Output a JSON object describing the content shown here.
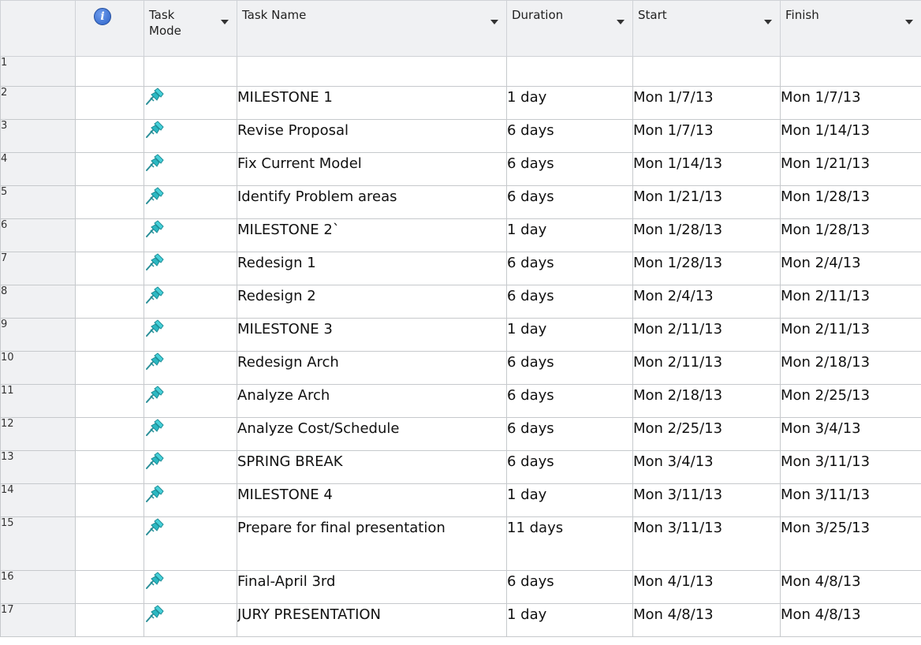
{
  "header": {
    "task_mode_label": "Task\nMode",
    "task_name_label": "Task Name",
    "duration_label": "Duration",
    "start_label": "Start",
    "finish_label": "Finish"
  },
  "icons": {
    "info": "info-icon",
    "task_mode": "pushpin-icon",
    "sort": "chevron-down-icon"
  },
  "colors": {
    "selected_header": "#fbd34d",
    "pin": "#27b3bd"
  },
  "rows": [
    {
      "id": "1",
      "name": "",
      "duration": "",
      "start": "",
      "finish": ""
    },
    {
      "id": "2",
      "name": "MILESTONE 1",
      "duration": "1 day",
      "start": "Mon 1/7/13",
      "finish": "Mon 1/7/13"
    },
    {
      "id": "3",
      "name": "Revise Proposal",
      "duration": "6 days",
      "start": "Mon 1/7/13",
      "finish": "Mon 1/14/13"
    },
    {
      "id": "4",
      "name": "Fix Current Model",
      "duration": "6 days",
      "start": "Mon 1/14/13",
      "finish": "Mon 1/21/13"
    },
    {
      "id": "5",
      "name": "Identify Problem areas",
      "duration": "6 days",
      "start": "Mon 1/21/13",
      "finish": "Mon 1/28/13"
    },
    {
      "id": "6",
      "name": "MILESTONE 2`",
      "duration": "1 day",
      "start": "Mon 1/28/13",
      "finish": "Mon 1/28/13"
    },
    {
      "id": "7",
      "name": "Redesign 1",
      "duration": "6 days",
      "start": "Mon 1/28/13",
      "finish": "Mon 2/4/13"
    },
    {
      "id": "8",
      "name": "Redesign 2",
      "duration": "6 days",
      "start": "Mon 2/4/13",
      "finish": "Mon 2/11/13"
    },
    {
      "id": "9",
      "name": "MILESTONE 3",
      "duration": "1 day",
      "start": "Mon 2/11/13",
      "finish": "Mon 2/11/13"
    },
    {
      "id": "10",
      "name": "Redesign Arch",
      "duration": "6 days",
      "start": "Mon 2/11/13",
      "finish": "Mon 2/18/13"
    },
    {
      "id": "11",
      "name": "Analyze Arch",
      "duration": "6 days",
      "start": "Mon 2/18/13",
      "finish": "Mon 2/25/13"
    },
    {
      "id": "12",
      "name": "Analyze Cost/Schedule",
      "duration": "6 days",
      "start": "Mon 2/25/13",
      "finish": "Mon 3/4/13"
    },
    {
      "id": "13",
      "name": "SPRING BREAK",
      "duration": "6 days",
      "start": "Mon 3/4/13",
      "finish": "Mon 3/11/13"
    },
    {
      "id": "14",
      "name": "MILESTONE 4",
      "duration": "1 day",
      "start": "Mon 3/11/13",
      "finish": "Mon 3/11/13"
    },
    {
      "id": "15",
      "name": "Prepare for final presentation",
      "duration": "11 days",
      "start": "Mon 3/11/13",
      "finish": "Mon 3/25/13"
    },
    {
      "id": "16",
      "name": "Final-April 3rd",
      "duration": "6 days",
      "start": "Mon 4/1/13",
      "finish": "Mon 4/8/13"
    },
    {
      "id": "17",
      "name": "JURY PRESENTATION",
      "duration": "1 day",
      "start": "Mon 4/8/13",
      "finish": "Mon 4/8/13"
    }
  ]
}
